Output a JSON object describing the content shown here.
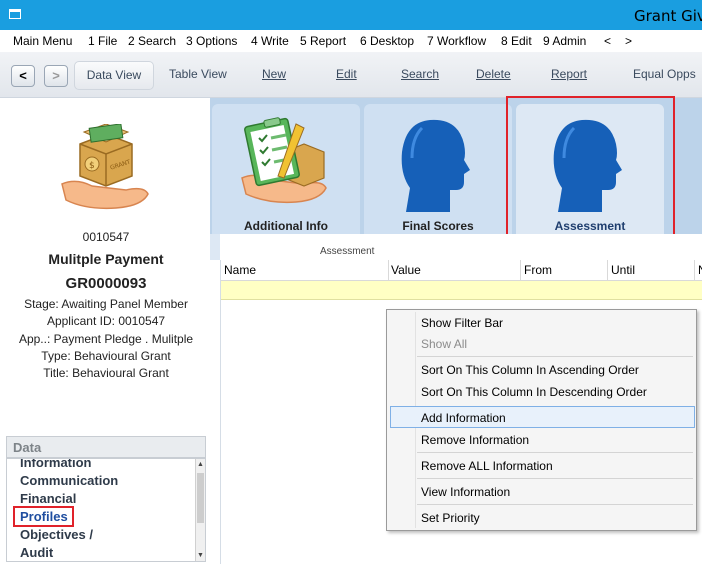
{
  "window": {
    "title": "Grant Givin"
  },
  "menu": [
    "Main Menu",
    "1 File",
    "2 Search",
    "3 Options",
    "4 Write",
    "5 Report",
    "6 Desktop",
    "7 Workflow",
    "8 Edit",
    "9 Admin",
    "<",
    ">"
  ],
  "toolbar": {
    "back": "<",
    "forward": ">",
    "buttons": [
      "Data View",
      "Table View",
      "New",
      "Edit",
      "Search",
      "Delete",
      "Report",
      "Equal Opps"
    ]
  },
  "record": {
    "id": "0010547",
    "name": "Mulitple Payment",
    "grant_ref": "GR0000093",
    "details": [
      "Stage: Awaiting Panel Member",
      "Applicant ID: 0010547",
      "App..: Payment Pledge . Mulitple",
      "Type: Behavioural Grant",
      "Title: Behavioural Grant"
    ]
  },
  "data_section": {
    "header": "Data",
    "items": [
      "Information",
      "Communication",
      "Financial",
      "Profiles",
      "Objectives /",
      "Audit"
    ]
  },
  "tabs": [
    {
      "label": "Additional Info",
      "icon": "clipboard-grant-icon"
    },
    {
      "label": "Final Scores",
      "icon": "head-profile-icon"
    },
    {
      "label": "Assessment",
      "icon": "head-profile-icon",
      "selected": true
    }
  ],
  "grid": {
    "caption": "Assessment",
    "columns": [
      "Name",
      "Value",
      "From",
      "Until",
      "N"
    ]
  },
  "context_menu": {
    "items": [
      {
        "label": "Show Filter Bar",
        "enabled": true
      },
      {
        "label": "Show All",
        "enabled": false
      },
      {
        "label": "Sort On This Column In Ascending Order",
        "enabled": true
      },
      {
        "label": "Sort On This Column In Descending Order",
        "enabled": true
      },
      {
        "label": "Add Information",
        "enabled": true,
        "highlighted": true
      },
      {
        "label": "Remove Information",
        "enabled": true
      },
      {
        "label": "Remove ALL Information",
        "enabled": true
      },
      {
        "label": "View Information",
        "enabled": true
      },
      {
        "label": "Set Priority",
        "enabled": true
      }
    ]
  },
  "colors": {
    "titlebar": "#1a9ee0",
    "highlight_box": "#e0222a",
    "head_icon": "#1660b8",
    "new_row": "#ffffc4"
  }
}
